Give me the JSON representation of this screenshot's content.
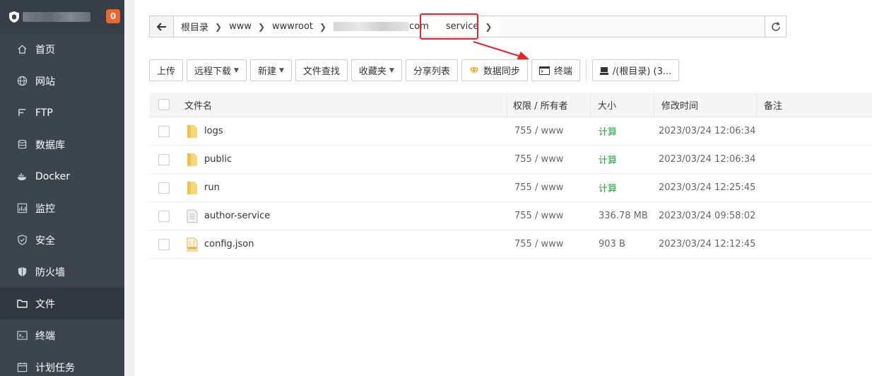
{
  "sidebar": {
    "badge": "0",
    "items": [
      {
        "label": "首页",
        "icon": "home-icon"
      },
      {
        "label": "网站",
        "icon": "globe-icon"
      },
      {
        "label": "FTP",
        "icon": "ftp-icon"
      },
      {
        "label": "数据库",
        "icon": "database-icon"
      },
      {
        "label": "Docker",
        "icon": "docker-icon"
      },
      {
        "label": "监控",
        "icon": "monitor-icon"
      },
      {
        "label": "安全",
        "icon": "shield-icon"
      },
      {
        "label": "防火墙",
        "icon": "firewall-icon"
      },
      {
        "label": "文件",
        "icon": "folder-icon",
        "active": true
      },
      {
        "label": "终端",
        "icon": "terminal-icon"
      },
      {
        "label": "计划任务",
        "icon": "calendar-icon"
      }
    ]
  },
  "breadcrumb": {
    "items": [
      "根目录",
      "www",
      "wwwroot",
      "com",
      "service"
    ]
  },
  "toolbar": {
    "upload": "上传",
    "remote_download": "远程下载",
    "new": "新建",
    "file_search": "文件查找",
    "favorites": "收藏夹",
    "share_list": "分享列表",
    "data_sync": "数据同步",
    "terminal": "终端",
    "disk": "/(根目录) (3..."
  },
  "table": {
    "headers": {
      "name": "文件名",
      "perm": "权限 / 所有者",
      "size": "大小",
      "mtime": "修改时间",
      "note": "备注"
    },
    "rows": [
      {
        "name": "logs",
        "type": "folder",
        "perm": "755 / www",
        "size": "计算",
        "mtime": "2023/03/24 12:06:34"
      },
      {
        "name": "public",
        "type": "folder",
        "perm": "755 / www",
        "size": "计算",
        "mtime": "2023/03/24 12:06:34"
      },
      {
        "name": "run",
        "type": "folder",
        "perm": "755 / www",
        "size": "计算",
        "mtime": "2023/03/24 12:25:45"
      },
      {
        "name": "author-service",
        "type": "file",
        "perm": "755 / www",
        "size": "336.78 MB",
        "mtime": "2023/03/24 09:58:02"
      },
      {
        "name": "config.json",
        "type": "json",
        "perm": "755 / www",
        "size": "903 B",
        "mtime": "2023/03/24 12:12:45"
      }
    ]
  },
  "colors": {
    "sidebar_bg": "#3c444d",
    "badge": "#f0642d",
    "highlight": "#e4252d",
    "calc_green": "#20a53a"
  }
}
